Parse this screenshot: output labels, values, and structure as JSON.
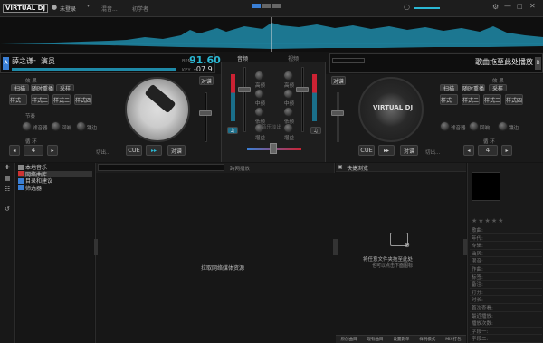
{
  "topbar": {
    "logo": "VIRTUAL DJ",
    "login": "未登录",
    "menu_items": [
      "混音...",
      "初学者"
    ]
  },
  "deck_left": {
    "artist": "薛之谦",
    "separator": " - ",
    "title": "演员",
    "bpm_label": "BPM",
    "bpm": "91.60",
    "key_label": "KEY",
    "pitch": "-07.9",
    "sync_label": "对谱",
    "tempo_label": "节奏",
    "loop_label": "循环",
    "effects_label": "效 果",
    "modes": [
      "扫描",
      "随时重播",
      "采样"
    ],
    "buttons": [
      "样式一",
      "样式二",
      "样式三",
      "样式四"
    ],
    "knob_labels": [
      "滤音器",
      "回响",
      "镶边"
    ],
    "loop_size_label": "循 环",
    "loop_value": "4",
    "cue": "CUE",
    "play": "▸▸",
    "sync": "对谱",
    "in_label": "切出..."
  },
  "deck_right": {
    "title": "歌曲拖至此处播放",
    "sync_label": "对谱",
    "effects_label": "效 果",
    "modes": [
      "扫描",
      "随时重播",
      "采样"
    ],
    "buttons": [
      "样式一",
      "样式二",
      "样式三",
      "样式四"
    ],
    "knob_labels": [
      "滤音器",
      "回响",
      "镶边"
    ],
    "loop_size_label": "循 环",
    "loop_value": "4",
    "cue": "CUE",
    "play": "▸▸",
    "sync": "对谱",
    "in_label": "切出..."
  },
  "mixer": {
    "left_label": "音频",
    "right_label": "视频",
    "eq_left": [
      "高频",
      "中频",
      "低频",
      "增益"
    ],
    "eq_right": [
      "高频",
      "中频",
      "低频",
      "增益"
    ],
    "center_label": "音乐淡出"
  },
  "browser": {
    "tree": [
      {
        "label": "本地音乐",
        "color": "#888"
      },
      {
        "label": "网络曲库",
        "color": "#c33"
      },
      {
        "label": "目录和建议",
        "color": "#3a7fd5"
      },
      {
        "label": "筛选器",
        "color": "#3a7fd5"
      }
    ],
    "search_hint": "跨网播放",
    "list_message": "拉取网络媒体资源",
    "quick_title": "快捷浏览",
    "drop_line1": "将任意文件夹拖至此处",
    "drop_line2": "也可以点击下面图标",
    "bottom_tabs": [
      "原创曲目",
      "现有曲目",
      "设置影单",
      "样例模式",
      "MIX打包"
    ],
    "meta_fields": [
      "歌曲:",
      "年代:",
      "专辑:",
      "曲风:",
      "混音:",
      "作曲:",
      "标签:",
      "备注:",
      "打分:",
      "时长:",
      "首次查看:",
      "最近播放:",
      "播放次数:",
      "字段一:",
      "字段二:"
    ]
  }
}
